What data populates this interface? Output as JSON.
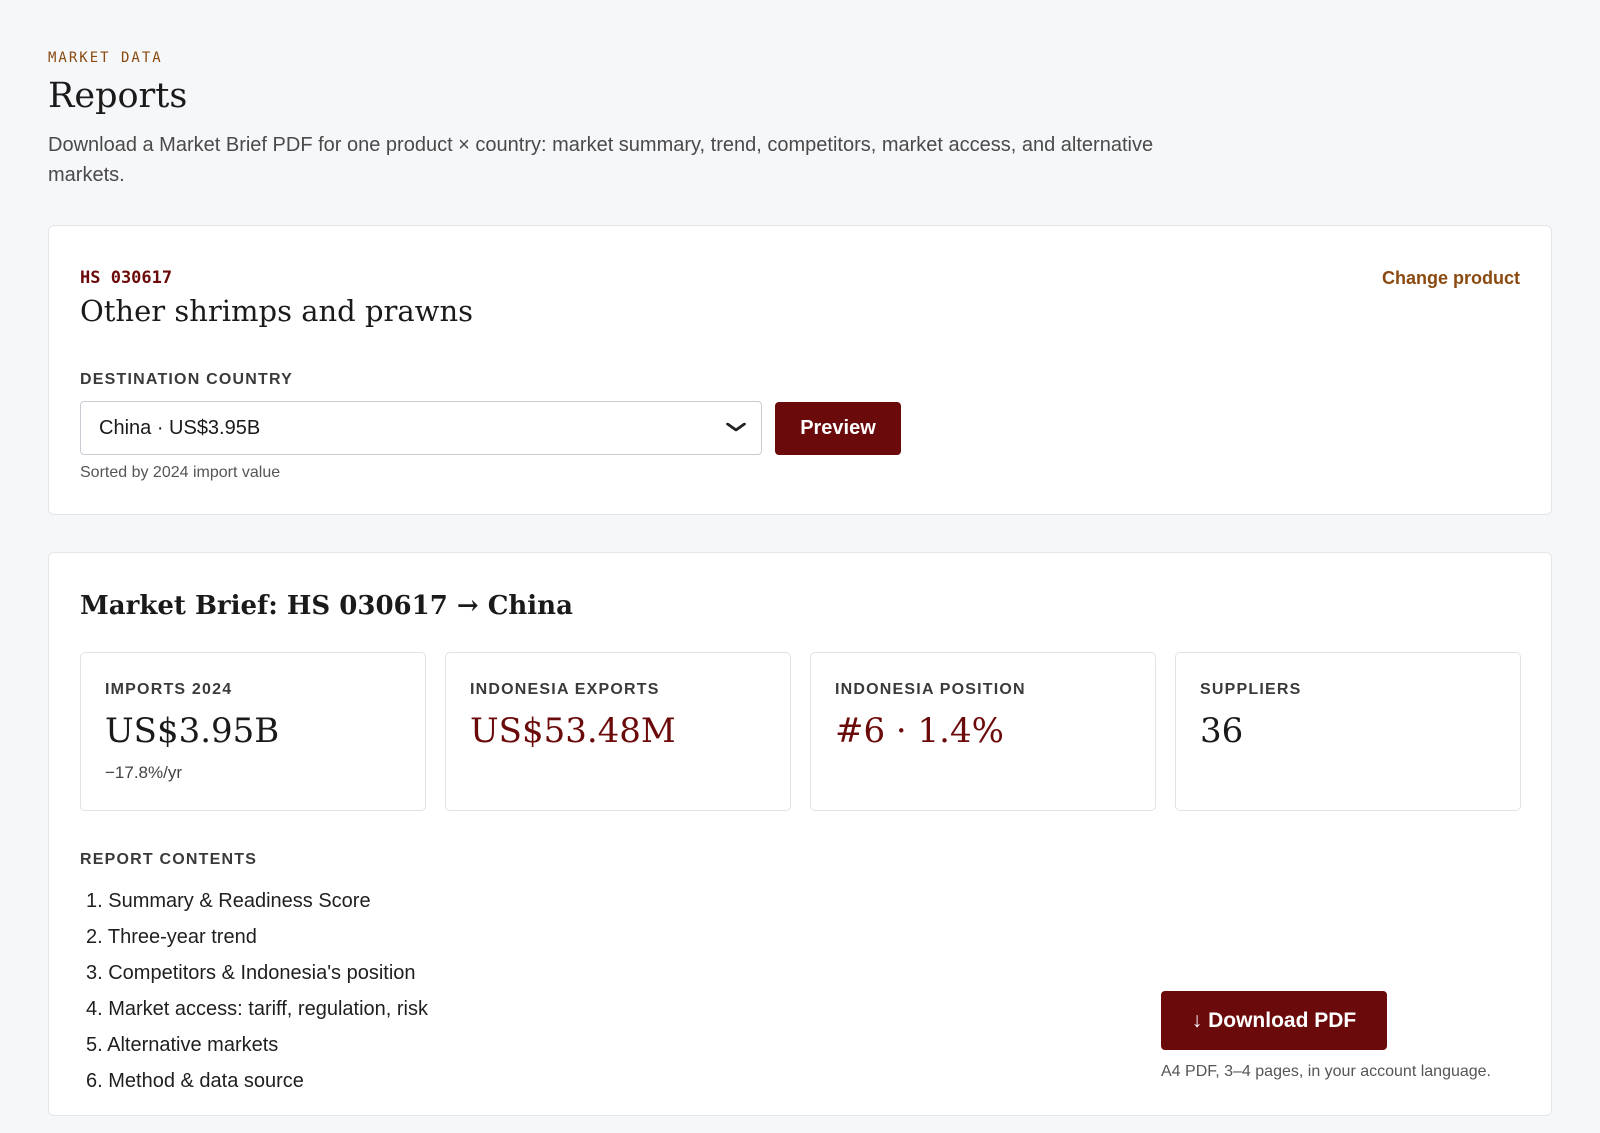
{
  "header": {
    "eyebrow": "MARKET DATA",
    "title": "Reports",
    "description": "Download a Market Brief PDF for one product × country: market summary, trend, competitors, market access, and alternative markets."
  },
  "product": {
    "hs_code": "HS 030617",
    "name": "Other shrimps and prawns",
    "change_label": "Change product",
    "destination_label": "DESTINATION COUNTRY",
    "selected_country": "China · US$3.95B",
    "preview_label": "Preview",
    "sort_hint": "Sorted by 2024 import value"
  },
  "brief": {
    "title": "Market Brief: HS 030617 → China",
    "stats": [
      {
        "label": "IMPORTS 2024",
        "value": "US$3.95B",
        "sub": "−17.8%/yr"
      },
      {
        "label": "INDONESIA EXPORTS",
        "value": "US$53.48M"
      },
      {
        "label": "INDONESIA POSITION",
        "value": "#6 · 1.4%"
      },
      {
        "label": "SUPPLIERS",
        "value": "36"
      }
    ],
    "contents_label": "REPORT CONTENTS",
    "contents": [
      "1. Summary & Readiness Score",
      "2. Three-year trend",
      "3. Competitors & Indonesia's position",
      "4. Market access: tariff, regulation, risk",
      "5. Alternative markets",
      "6. Method & data source"
    ],
    "download_label": "↓ Download PDF",
    "download_hint": "A4 PDF, 3–4 pages, in your account language."
  },
  "colors": {
    "accent": "#6b0a0a",
    "link": "#8a4a10",
    "background": "#f6f7f9"
  },
  "icons": {
    "select_chevron": "chevron-down-icon",
    "download": "download-arrow-icon"
  }
}
